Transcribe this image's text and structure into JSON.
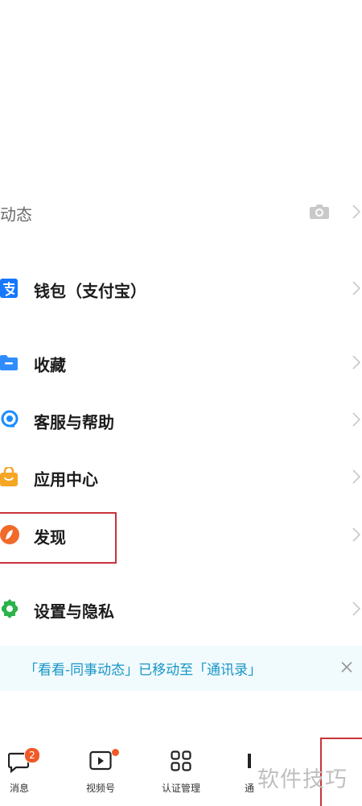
{
  "menu": {
    "moments": {
      "label": "动态",
      "icon": "camera-icon"
    },
    "items": [
      {
        "label": "钱包（支付宝）",
        "icon": "alipay-icon",
        "color": "#1677ff"
      },
      {
        "label": "收藏",
        "icon": "folder-icon",
        "color": "#2f8cff"
      },
      {
        "label": "客服与帮助",
        "icon": "support-icon",
        "color": "#1a8cff"
      },
      {
        "label": "应用中心",
        "icon": "shopping-bag-icon",
        "color": "#f5a623"
      },
      {
        "label": "发现",
        "icon": "compass-icon",
        "color": "#f06a2a"
      },
      {
        "label": "设置与隐私",
        "icon": "gear-icon",
        "color": "#2bb34a"
      }
    ]
  },
  "banner": {
    "text": "「看看-同事动态」已移动至「通讯录」",
    "close_icon": "close-icon"
  },
  "tabbar": {
    "tabs": [
      {
        "label": "消息",
        "icon": "chat-bubble-icon",
        "badge": "2"
      },
      {
        "label": "视频号",
        "icon": "video-icon"
      },
      {
        "label": "认证管理",
        "icon": "grid-icon"
      },
      {
        "label": "通",
        "icon": "contacts-icon"
      }
    ]
  },
  "watermark": "软件技巧",
  "colors": {
    "highlight": "#c8333b",
    "banner_bg": "#f1fafc",
    "banner_text": "#1796c8",
    "badge": "#f05a28"
  }
}
